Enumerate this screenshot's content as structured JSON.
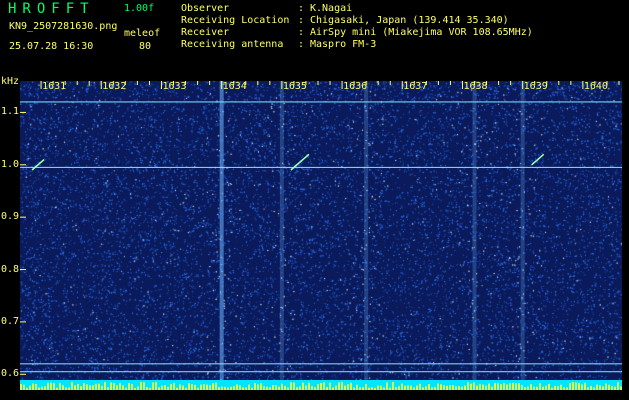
{
  "header": {
    "app_title": "HROFFT",
    "version": "1.00f",
    "filename": "KN9_2507281630.png",
    "mode": "meleof",
    "timestamp": "25.07.28 16:30",
    "mode_value": "80",
    "info": [
      {
        "label": "Observer",
        "value": "K.Nagai"
      },
      {
        "label": "Receiving Location",
        "value": "Chigasaki, Japan (139.414 35.340)"
      },
      {
        "label": "Receiver",
        "value": "AirSpy mini (Miakejima VOR 108.65MHz)"
      },
      {
        "label": "Receiving antenna",
        "value": "Maspro FM-3"
      }
    ],
    "separator": ":"
  },
  "chart_data": {
    "type": "heatmap",
    "ylabel": "kHz",
    "x_tick_labels": [
      "1631",
      "1632",
      "1633",
      "1634",
      "1635",
      "1636",
      "1637",
      "1638",
      "1639",
      "1640"
    ],
    "y_tick_labels": [
      "1.1",
      "1.0",
      "0.9",
      "0.8",
      "0.7",
      "0.6"
    ],
    "y_ticks": [
      1.1,
      1.0,
      0.9,
      0.8,
      0.7,
      0.6
    ],
    "ylim": [
      0.57,
      1.16
    ],
    "xlim": [
      1630.65,
      1640.65
    ],
    "carrier_lines_khz": [
      1.12,
      0.995,
      0.62,
      0.605
    ],
    "vertical_streaks": [
      1634.0,
      1635.0,
      1636.4,
      1638.2,
      1639.0
    ],
    "meteor_echoes": [
      {
        "x": [
          1630.85,
          1631.05
        ],
        "y": [
          0.99,
          1.01
        ]
      },
      {
        "x": [
          1635.15,
          1635.45
        ],
        "y": [
          0.99,
          1.02
        ]
      },
      {
        "x": [
          1639.15,
          1639.35
        ],
        "y": [
          1.0,
          1.02
        ]
      }
    ],
    "colors": {
      "background": "#0a1a5a",
      "noise": "#2e7bff",
      "line": "#7fe8ff",
      "baseline": "#00e5ff",
      "burst": "#ffff33"
    }
  }
}
